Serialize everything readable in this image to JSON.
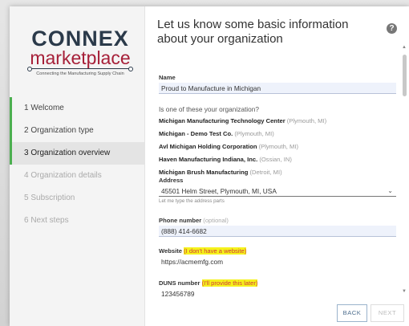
{
  "logo": {
    "brand": "CONNEX",
    "sub": "marketplace",
    "tagline": "Connecting the Manufacturing Supply Chain"
  },
  "steps": [
    {
      "label": "1  Welcome",
      "state": "done"
    },
    {
      "label": "2  Organization type",
      "state": "done"
    },
    {
      "label": "3  Organization overview",
      "state": "active"
    },
    {
      "label": "4  Organization details",
      "state": "disabled"
    },
    {
      "label": "5  Subscription",
      "state": "disabled"
    },
    {
      "label": "6  Next steps",
      "state": "disabled"
    }
  ],
  "main": {
    "title": "Let us know some basic information about your organization",
    "help_icon": "?"
  },
  "form": {
    "name_label": "Name",
    "name_value": "Proud to Manufacture in Michigan",
    "question": "Is one of these your organization?",
    "orgs": [
      {
        "name": "Michigan Manufacturing Technology Center",
        "location": "(Plymouth, MI)"
      },
      {
        "name": "Michigan - Demo Test Co.",
        "location": "(Plymouth, MI)"
      },
      {
        "name": "Avl Michigan Holding Corporation",
        "location": "(Plymouth, MI)"
      },
      {
        "name": "Haven Manufacturing Indiana, Inc.",
        "location": "(Ossian, IN)"
      },
      {
        "name": "Michigan Brush Manufacturing",
        "location": "(Detroit, MI)"
      }
    ],
    "address_label": "Address",
    "address_value": "45501 Helm Street, Plymouth, MI, USA",
    "address_hint": "Let me type the address parts",
    "phone_label": "Phone number",
    "phone_optional": "(optional)",
    "phone_value": "(888) 414-6682",
    "website_label": "Website",
    "website_link": "(I don't have a website)",
    "website_value": "https://acmemfg.com",
    "duns_label": "DUNS number",
    "duns_link": "(I'll provide this later)",
    "duns_value": "123456789"
  },
  "buttons": {
    "back": "BACK",
    "next": "NEXT"
  },
  "colors": {
    "accent_green": "#4caf50",
    "brand_red": "#a61f38",
    "brand_navy": "#2b3a4a",
    "highlight": "#f5f21c"
  }
}
